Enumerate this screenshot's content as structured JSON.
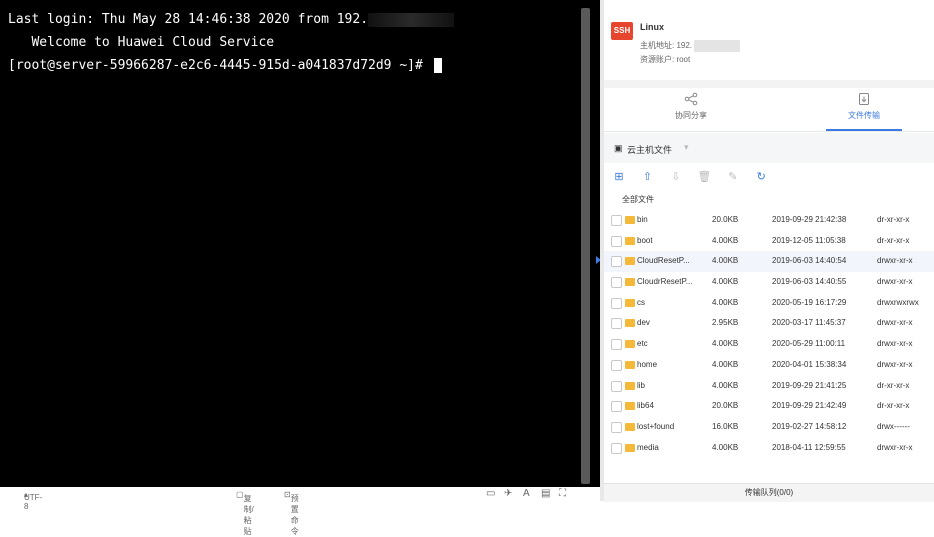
{
  "terminal": {
    "last_login": "Last login: Thu May 28 14:46:38 2020 from 192.",
    "welcome": "   Welcome to Huawei Cloud Service",
    "prompt": "[root@server-59966287-e2c6-4445-915d-a041837d72d9 ~]# "
  },
  "statusbar": {
    "encoding": "UTF-8",
    "copy_paste": "复制/粘贴",
    "preset_cmd": "预置命令"
  },
  "info": {
    "badge": "SSH",
    "title": "Linux",
    "host_label": "主机地址: 192.",
    "account_label": "资源账户: root"
  },
  "tabs": [
    {
      "label": "协同分享",
      "icon": "share-icon"
    },
    {
      "label": "文件传输",
      "icon": "file-transfer-icon"
    }
  ],
  "hostbar": {
    "label": "云主机文件"
  },
  "breadcrumb": "全部文件",
  "files": [
    {
      "name": "bin",
      "size": "20.0KB",
      "date": "2019-09-29 21:42:38",
      "perm": "dr-xr-xr-x"
    },
    {
      "name": "boot",
      "size": "4.00KB",
      "date": "2019-12-05 11:05:38",
      "perm": "dr-xr-xr-x"
    },
    {
      "name": "CloudResetP...",
      "size": "4.00KB",
      "date": "2019-06-03 14:40:54",
      "perm": "drwxr-xr-x"
    },
    {
      "name": "CloudrResetP...",
      "size": "4.00KB",
      "date": "2019-06-03 14:40:55",
      "perm": "drwxr-xr-x"
    },
    {
      "name": "cs",
      "size": "4.00KB",
      "date": "2020-05-19 16:17:29",
      "perm": "drwxrwxrwx"
    },
    {
      "name": "dev",
      "size": "2.95KB",
      "date": "2020-03-17 11:45:37",
      "perm": "drwxr-xr-x"
    },
    {
      "name": "etc",
      "size": "4.00KB",
      "date": "2020-05-29 11:00:11",
      "perm": "drwxr-xr-x"
    },
    {
      "name": "home",
      "size": "4.00KB",
      "date": "2020-04-01 15:38:34",
      "perm": "drwxr-xr-x"
    },
    {
      "name": "lib",
      "size": "4.00KB",
      "date": "2019-09-29 21:41:25",
      "perm": "dr-xr-xr-x"
    },
    {
      "name": "lib64",
      "size": "20.0KB",
      "date": "2019-09-29 21:42:49",
      "perm": "dr-xr-xr-x"
    },
    {
      "name": "lost+found",
      "size": "16.0KB",
      "date": "2019-02-27 14:58:12",
      "perm": "drwx------"
    },
    {
      "name": "media",
      "size": "4.00KB",
      "date": "2018-04-11 12:59:55",
      "perm": "drwxr-xr-x"
    }
  ],
  "queue": "传输队列(0/0)",
  "colors": {
    "accent": "#3b7ae0",
    "ssh_badge": "#e6462d",
    "folder": "#f5b93a",
    "terminal_bg": "#000000"
  }
}
